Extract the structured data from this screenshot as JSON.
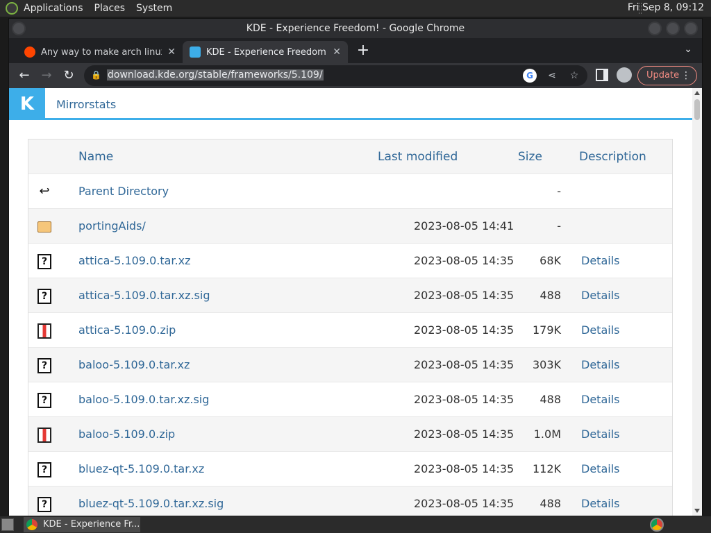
{
  "top_panel": {
    "menus": [
      "Applications",
      "Places",
      "System"
    ],
    "clock": "Fri Sep  8, 09:12"
  },
  "window": {
    "title": "KDE - Experience Freedom! - Google Chrome"
  },
  "tabs": [
    {
      "title": "Any way to make arch linux lo",
      "favicon": "reddit-icon",
      "active": false
    },
    {
      "title": "KDE - Experience Freedom!",
      "favicon": "kde-icon",
      "active": true
    }
  ],
  "toolbar": {
    "url": "download.kde.org/stable/frameworks/5.109/",
    "update_label": "Update"
  },
  "page": {
    "header_link": "Mirrorstats",
    "columns": {
      "name": "Name",
      "modified": "Last modified",
      "size": "Size",
      "description": "Description"
    },
    "rows": [
      {
        "icon": "back-icon",
        "name": "Parent Directory",
        "date": "",
        "size": "-",
        "desc": ""
      },
      {
        "icon": "folder-icon",
        "name": "portingAids/",
        "date": "2023-08-05 14:41",
        "size": "-",
        "desc": ""
      },
      {
        "icon": "unknown-file-icon",
        "name": "attica-5.109.0.tar.xz",
        "date": "2023-08-05 14:35",
        "size": "68K",
        "desc": "Details"
      },
      {
        "icon": "unknown-file-icon",
        "name": "attica-5.109.0.tar.xz.sig",
        "date": "2023-08-05 14:35",
        "size": "488",
        "desc": "Details"
      },
      {
        "icon": "zip-file-icon",
        "name": "attica-5.109.0.zip",
        "date": "2023-08-05 14:35",
        "size": "179K",
        "desc": "Details"
      },
      {
        "icon": "unknown-file-icon",
        "name": "baloo-5.109.0.tar.xz",
        "date": "2023-08-05 14:35",
        "size": "303K",
        "desc": "Details"
      },
      {
        "icon": "unknown-file-icon",
        "name": "baloo-5.109.0.tar.xz.sig",
        "date": "2023-08-05 14:35",
        "size": "488",
        "desc": "Details"
      },
      {
        "icon": "zip-file-icon",
        "name": "baloo-5.109.0.zip",
        "date": "2023-08-05 14:35",
        "size": "1.0M",
        "desc": "Details"
      },
      {
        "icon": "unknown-file-icon",
        "name": "bluez-qt-5.109.0.tar.xz",
        "date": "2023-08-05 14:35",
        "size": "112K",
        "desc": "Details"
      },
      {
        "icon": "unknown-file-icon",
        "name": "bluez-qt-5.109.0.tar.xz.sig",
        "date": "2023-08-05 14:35",
        "size": "488",
        "desc": "Details"
      }
    ]
  },
  "taskbar": {
    "task_label": "KDE - Experience Fr..."
  },
  "colors": {
    "kde_blue": "#3daee9",
    "link_blue": "#2f6797",
    "update_red": "#f28b82"
  }
}
